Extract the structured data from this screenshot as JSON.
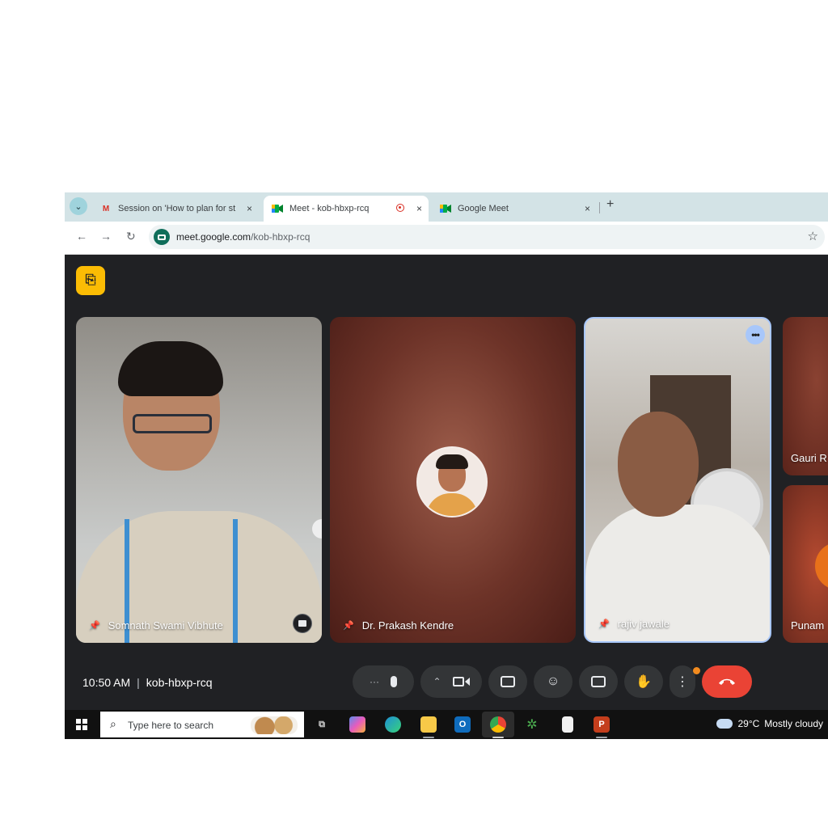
{
  "browser": {
    "tabs": [
      {
        "title": "Session on 'How to plan for st",
        "favicon": "gmail-icon",
        "active": false
      },
      {
        "title": "Meet - kob-hbxp-rcq",
        "favicon": "meet-icon",
        "active": true,
        "recording": true
      },
      {
        "title": "Google Meet",
        "favicon": "meet-icon",
        "active": false
      }
    ],
    "new_tab": "+",
    "close_glyph": "×",
    "url_domain": "meet.google.com",
    "url_path": "/kob-hbxp-rcq"
  },
  "meet": {
    "participants": [
      {
        "name": "Somnath Swami Vibhute"
      },
      {
        "name": "Dr. Prakash Kendre"
      },
      {
        "name": "rajiv jawale"
      },
      {
        "name": "Gauri R"
      },
      {
        "name": "Punam"
      }
    ],
    "time": "10:50 AM",
    "meeting_code": "kob-hbxp-rcq",
    "separator": "|",
    "controls": [
      "more-options",
      "microphone",
      "camera",
      "present",
      "reactions",
      "captions",
      "raise-hand",
      "options",
      "leave-call"
    ],
    "notification_color": "#f28b1f",
    "leave_color": "#ea4335",
    "active_tile_border": "#a8c7fa"
  },
  "taskbar": {
    "search_placeholder": "Type here to search",
    "apps": [
      "task-view",
      "copilot",
      "edge",
      "file-explorer",
      "outlook",
      "chrome",
      "app-leaf",
      "notepad",
      "powerpoint"
    ],
    "weather_temp": "29°C",
    "weather_text": "Mostly cloudy"
  }
}
